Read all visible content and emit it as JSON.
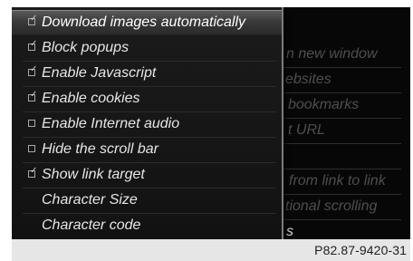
{
  "popup": {
    "items": [
      {
        "label": "Download images automatically",
        "checkbox": true,
        "checked": true,
        "selected": true
      },
      {
        "label": "Block popups",
        "checkbox": true,
        "checked": true,
        "selected": false
      },
      {
        "label": "Enable Javascript",
        "checkbox": true,
        "checked": true,
        "selected": false
      },
      {
        "label": "Enable cookies",
        "checkbox": true,
        "checked": true,
        "selected": false
      },
      {
        "label": "Enable Internet audio",
        "checkbox": true,
        "checked": false,
        "selected": false
      },
      {
        "label": "Hide the scroll bar",
        "checkbox": true,
        "checked": false,
        "selected": false
      },
      {
        "label": "Show link target",
        "checkbox": true,
        "checked": true,
        "selected": false
      },
      {
        "label": "Character Size",
        "checkbox": false,
        "checked": false,
        "selected": false
      },
      {
        "label": "Character code",
        "checkbox": false,
        "checked": false,
        "selected": false
      }
    ]
  },
  "background_menu": {
    "items": [
      "n new window",
      "ebsites",
      "bookmarks",
      "t URL",
      "",
      "from link to link",
      "tional scrolling",
      "s"
    ]
  },
  "footer": {
    "figure_code": "P82.87-9420-31"
  },
  "colors": {
    "screen_bg": "#070707",
    "selection": "#4a4a4a",
    "text": "#e6e6e6",
    "dim_text": "#4e4e4e"
  }
}
